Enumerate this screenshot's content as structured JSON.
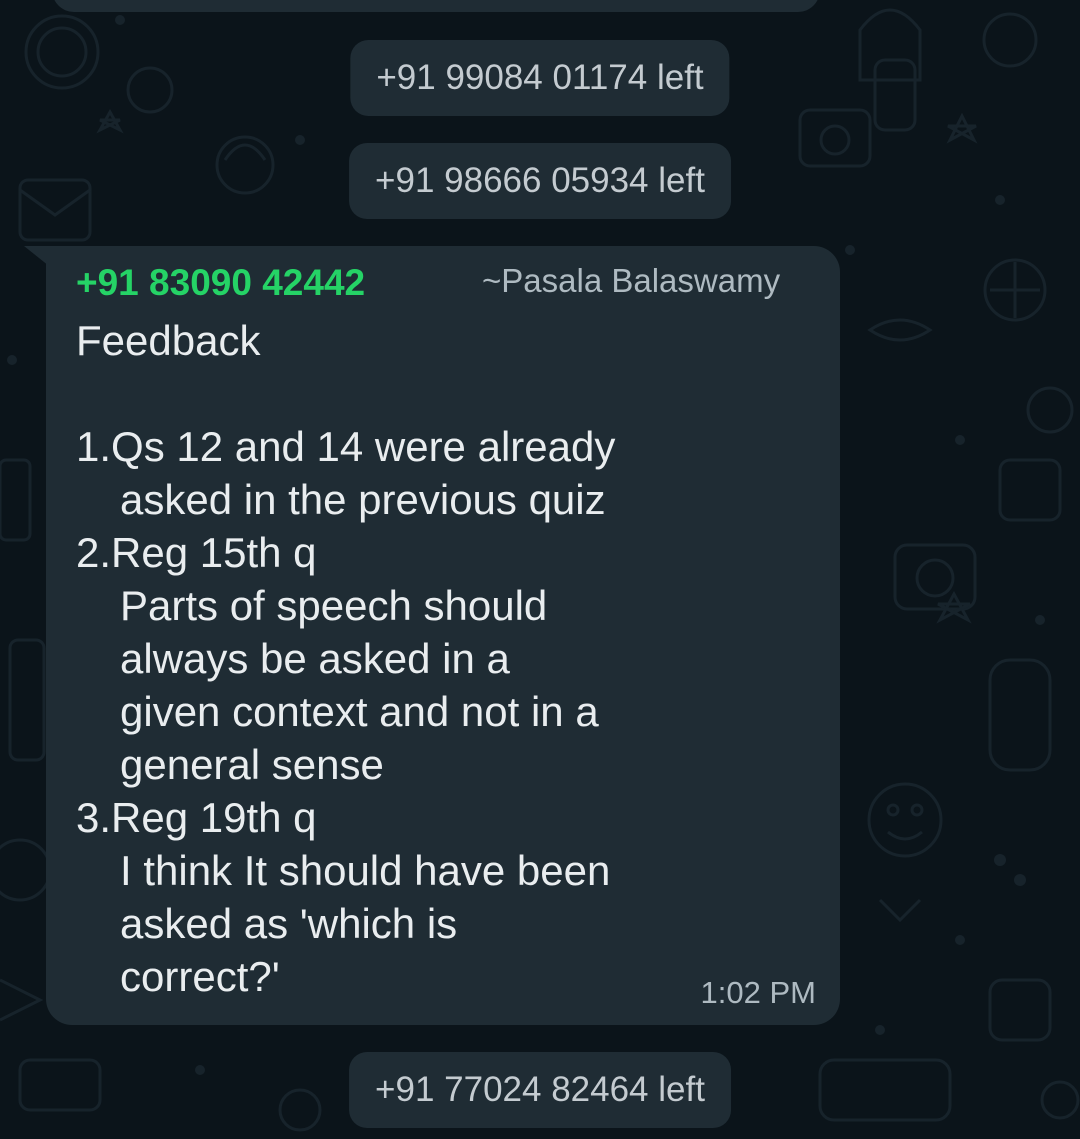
{
  "system_messages": [
    {
      "text": "+91 99084 01174 left"
    },
    {
      "text": "+91 98666 05934 left"
    },
    {
      "text": "+91 77024 82464 left"
    }
  ],
  "message": {
    "sender_phone": "+91 83090 42442",
    "sender_name": "~Pasala Balaswamy",
    "heading": "Feedback",
    "items": [
      {
        "num": "1.",
        "lines": [
          "Qs 12 and 14 were already",
          "asked in the previous quiz"
        ]
      },
      {
        "num": "2.",
        "lines": [
          "Reg 15th q",
          "Parts of speech should",
          "always be asked in a",
          "given context and not in a",
          "general sense"
        ]
      },
      {
        "num": "3.",
        "lines": [
          "Reg 19th q",
          "I think It should have been",
          "asked as 'which is",
          "correct?'"
        ]
      }
    ],
    "time": "1:02 PM"
  },
  "colors": {
    "background": "#0b141a",
    "bubble": "#1f2c34",
    "sender_phone": "#25d366",
    "text": "#e9edef",
    "muted": "#aebac1"
  }
}
